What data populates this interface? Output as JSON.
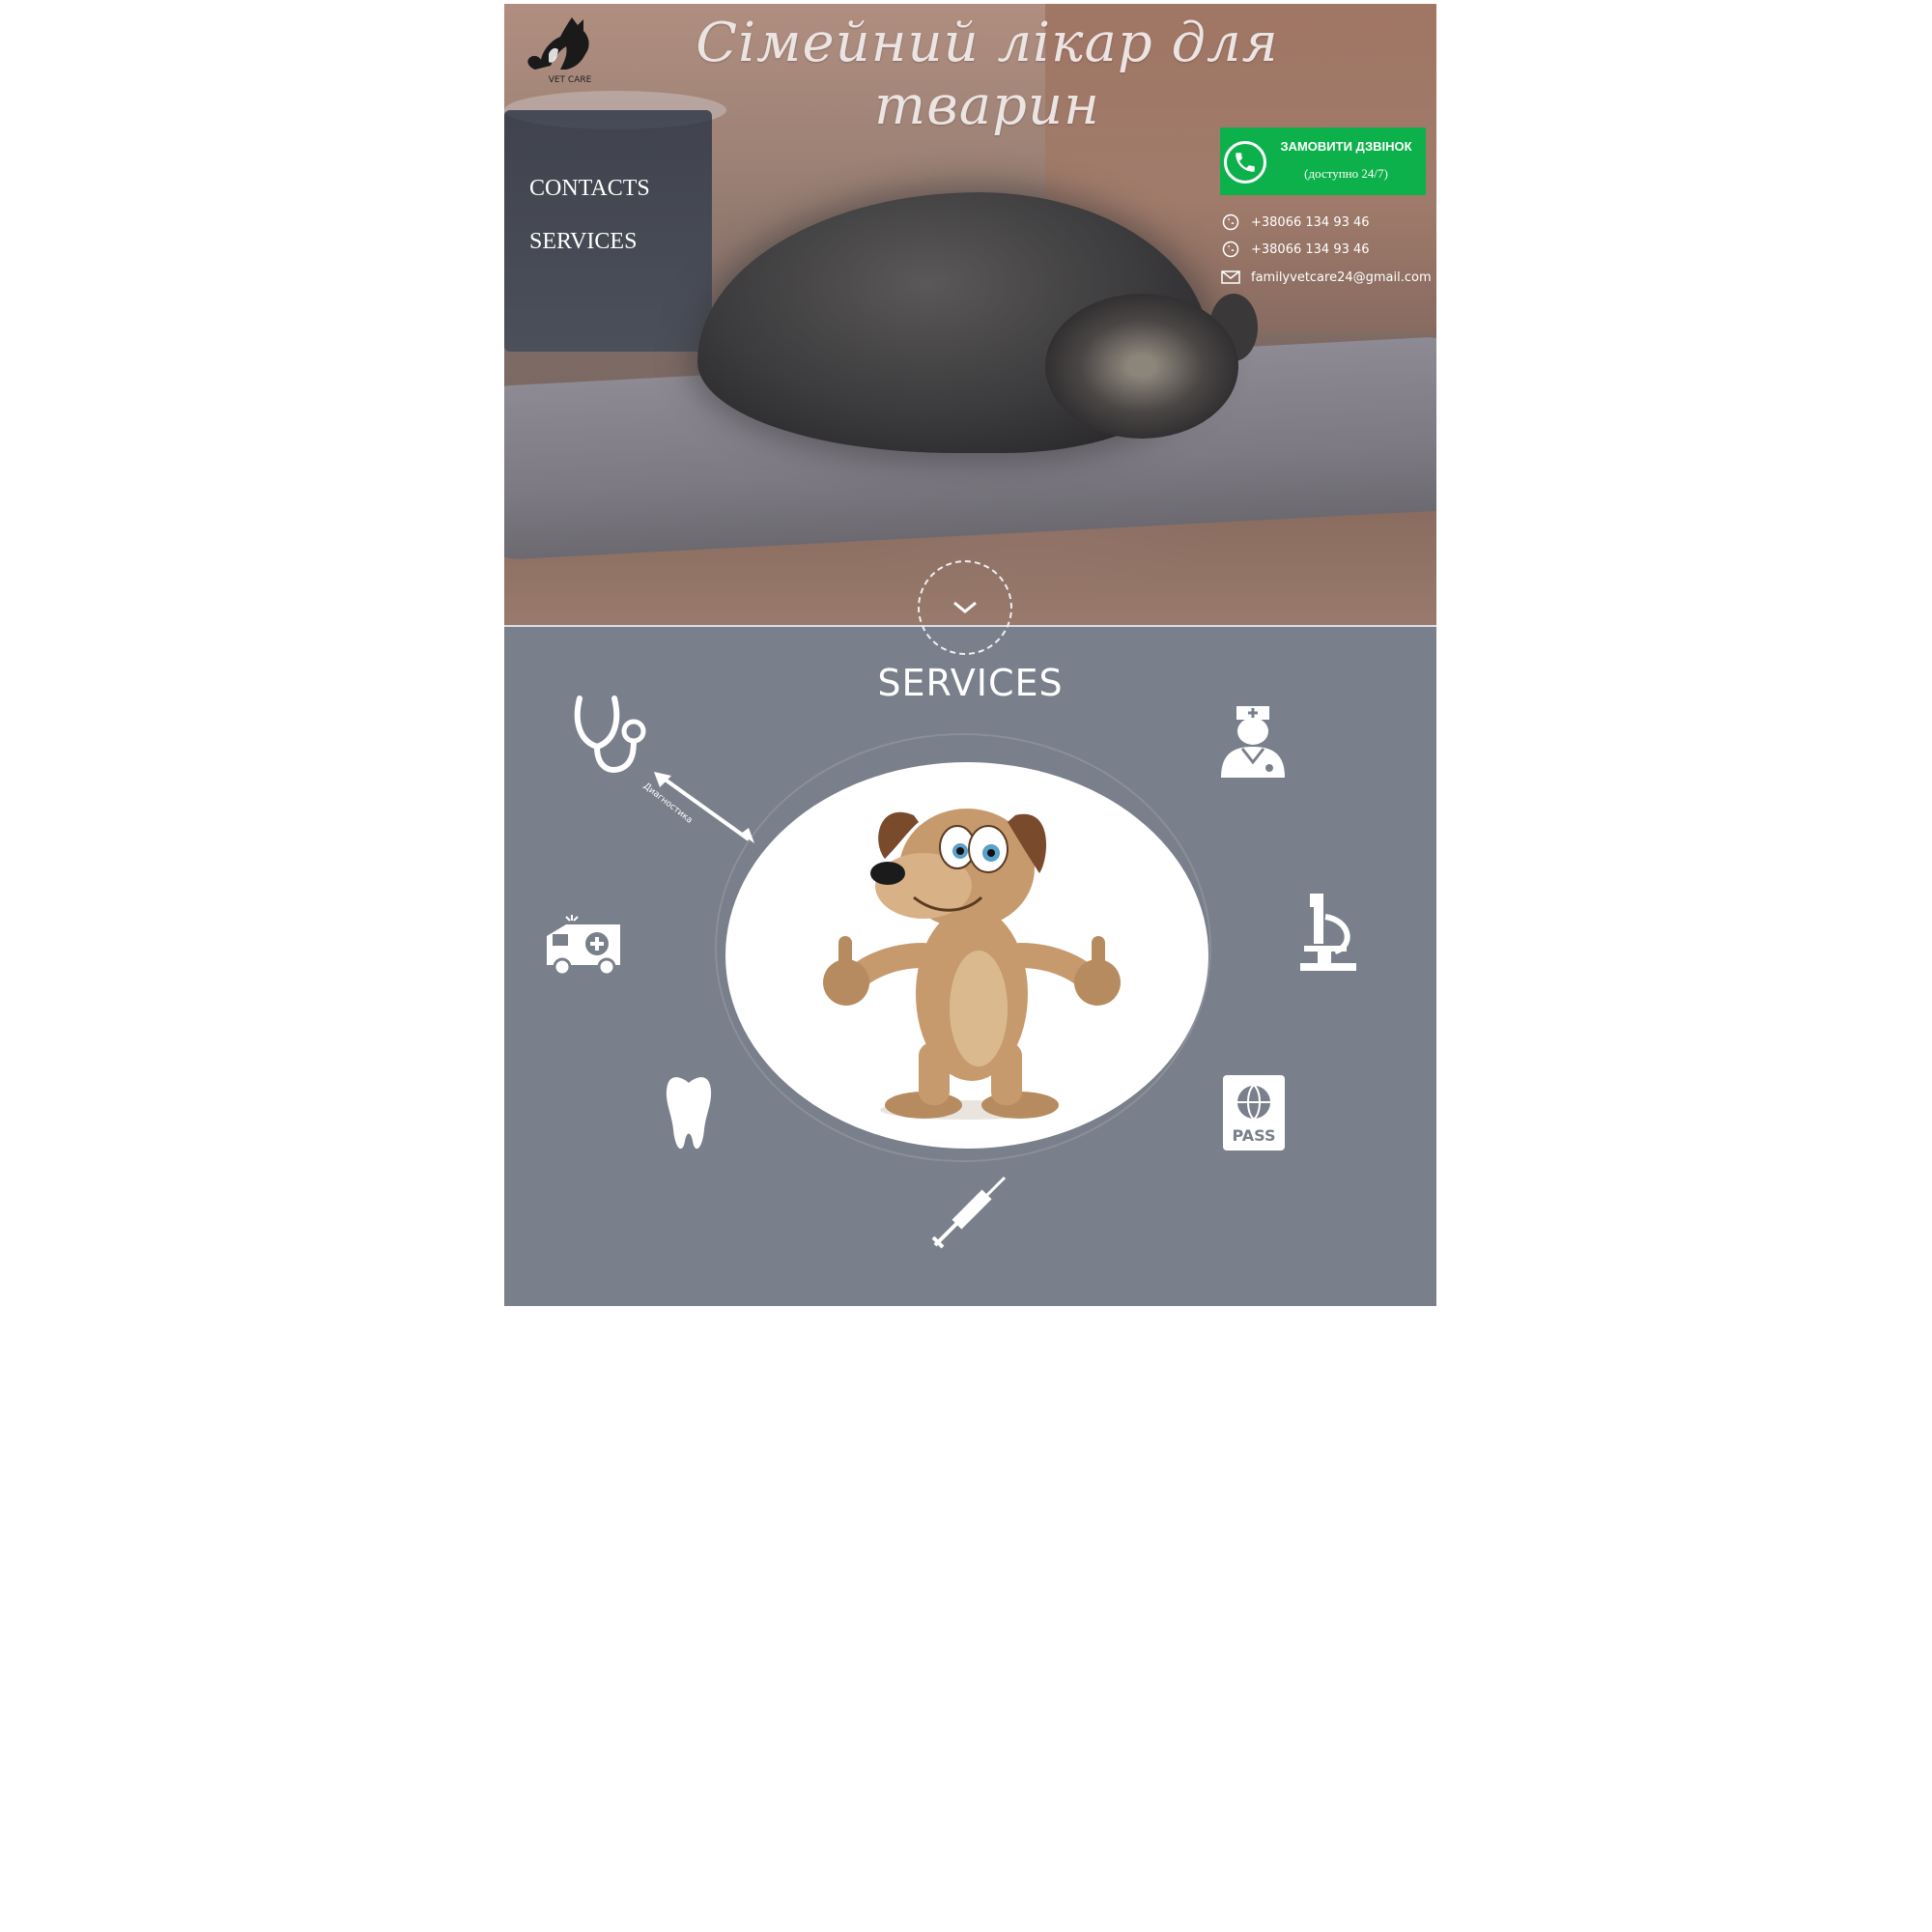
{
  "header": {
    "logo_text": "VET CARE",
    "title": "Сімейний лікар для тварин"
  },
  "nav": {
    "items": [
      {
        "label": "CONTACTS"
      },
      {
        "label": "SERVICES"
      }
    ]
  },
  "call": {
    "title": "ЗАМОВИТИ ДЗВІНОК",
    "subtitle": "(доступно 24/7)",
    "color": "#0db14b"
  },
  "contacts": {
    "phone1": "+38066 134 93 46",
    "phone2": "+38066 134 93 46",
    "email": "familyvetcare24@gmail.com"
  },
  "services": {
    "title": "SERVICES",
    "arrow_label": "Диагностика",
    "background": "#7a808b",
    "icons": [
      "stethoscope-icon",
      "ambulance-icon",
      "tooth-icon",
      "syringe-icon",
      "passport-icon",
      "microscope-icon",
      "nurse-icon"
    ],
    "passport_text": "PASS"
  }
}
